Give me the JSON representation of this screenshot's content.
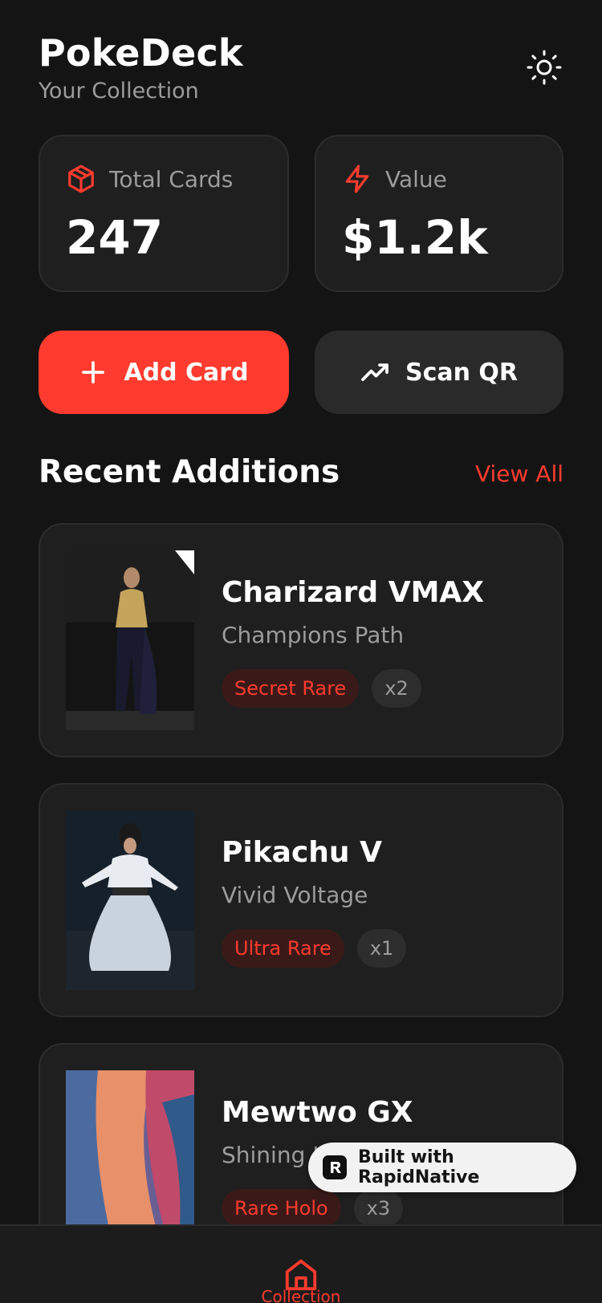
{
  "header": {
    "title": "PokeDeck",
    "subtitle": "Your Collection",
    "theme_icon": "sun-icon"
  },
  "stats": [
    {
      "icon": "cube-icon",
      "label": "Total Cards",
      "value": "247"
    },
    {
      "icon": "lightning-icon",
      "label": "Value",
      "value": "$1.2k"
    }
  ],
  "actions": {
    "add_label": "Add Card",
    "add_icon": "plus-icon",
    "scan_label": "Scan QR",
    "scan_icon": "trending-up-icon"
  },
  "recent": {
    "title": "Recent Additions",
    "view_all": "View All",
    "cards": [
      {
        "name": "Charizard VMAX",
        "set": "Champions Path",
        "rarity": "Secret Rare",
        "quantity": "x2"
      },
      {
        "name": "Pikachu V",
        "set": "Vivid Voltage",
        "rarity": "Ultra Rare",
        "quantity": "x1"
      },
      {
        "name": "Mewtwo GX",
        "set": "Shining Legends",
        "rarity": "Rare Holo",
        "quantity": "x3"
      }
    ]
  },
  "badge": {
    "label": "Built with RapidNative"
  },
  "tabbar": {
    "items": [
      {
        "label": "Collection",
        "icon": "home-icon",
        "active": true
      }
    ]
  },
  "colors": {
    "accent": "#ff3b2f",
    "background": "#141414",
    "card": "#1f1f1f"
  }
}
